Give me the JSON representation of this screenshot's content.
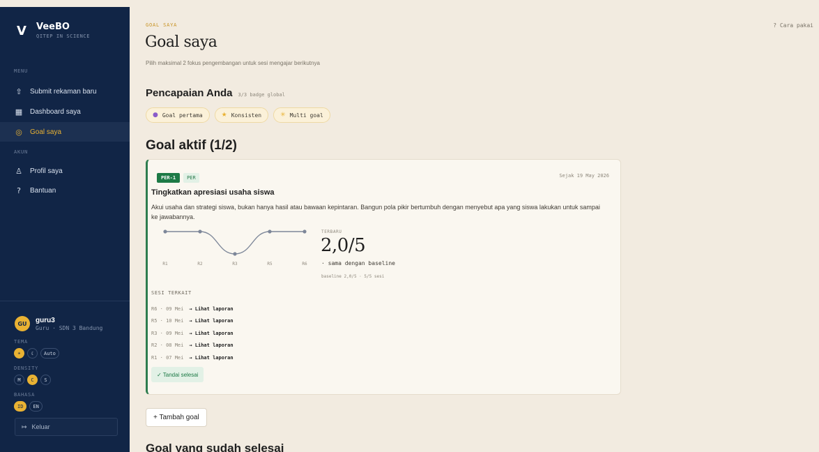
{
  "sidebar": {
    "brand": {
      "logo": "V",
      "name": "VeeBO",
      "subtitle": "QITEP IN SCIENCE"
    },
    "menu_label": "MENU",
    "menu_items": [
      {
        "label": "Submit rekaman baru",
        "icon": "upload-icon",
        "glyph": "⇧"
      },
      {
        "label": "Dashboard saya",
        "icon": "grid-icon",
        "glyph": "▦"
      },
      {
        "label": "Goal saya",
        "icon": "target-icon",
        "glyph": "◎",
        "active": true
      }
    ],
    "account_label": "AKUN",
    "account_items": [
      {
        "label": "Profil saya",
        "icon": "user-icon",
        "glyph": "♙"
      },
      {
        "label": "Bantuan",
        "icon": "help-icon",
        "glyph": "?"
      }
    ],
    "user": {
      "initials": "GU",
      "name": "guru3",
      "role": "Guru · SDN 3 Bandung"
    },
    "theme": {
      "label": "TEMA",
      "options": [
        "☀",
        "☾",
        "Auto"
      ],
      "selected": "☀"
    },
    "density": {
      "label": "DENSITY",
      "options": [
        "M",
        "C",
        "S"
      ],
      "selected": "C"
    },
    "language": {
      "label": "BAHASA",
      "options": [
        "ID",
        "EN"
      ],
      "selected": "ID"
    },
    "logout_icon": "logout-icon",
    "logout_label": "Keluar"
  },
  "header": {
    "eyebrow": "GOAL SAYA",
    "title": "Goal saya",
    "subtitle": "Pilih maksimal 2 fokus pengembangan untuk sesi mengajar berikutnya",
    "help": "? Cara pakai"
  },
  "achievements": {
    "title": "Pencapaian Anda",
    "count": "3/3 badge global",
    "badges": [
      {
        "label": "Goal pertama",
        "icon": "target-icon",
        "glyph": "●",
        "color": "#8a5cc9"
      },
      {
        "label": "Konsisten",
        "icon": "star-icon",
        "glyph": "★",
        "color": "#e9b233"
      },
      {
        "label": "Multi goal",
        "icon": "sparkle-icon",
        "glyph": "✳",
        "color": "#e9b233"
      }
    ]
  },
  "active_goals": {
    "title": "Goal aktif (1/2)",
    "goals": [
      {
        "code": "PER-1",
        "category": "PER",
        "since": "Sejak 19 May 2026",
        "title": "Tingkatkan apresiasi usaha siswa",
        "description": "Akui usaha dan strategi siswa, bukan hanya hasil atau bawaan kepintaran. Bangun pola pikir bertumbuh dengan menyebut apa yang siswa lakukan untuk sampai ke jawabannya.",
        "trend": {
          "labels": [
            "R1",
            "R2",
            "R3",
            "R5",
            "R6"
          ],
          "values": [
            2,
            2,
            1,
            2,
            2
          ],
          "ylim": [
            0,
            5
          ]
        },
        "latest_label": "TERBARU",
        "latest_value": "2,0/5",
        "comparison": "· sama dengan baseline",
        "baseline": "baseline 2,0/5 · 5/5 sesi",
        "sessions_label": "SESI TERKAIT",
        "sessions": [
          {
            "meta": "R6 · 09 Mei",
            "link": "→ Lihat laporan"
          },
          {
            "meta": "R5 · 10 Mei",
            "link": "→ Lihat laporan"
          },
          {
            "meta": "R3 · 09 Mei",
            "link": "→ Lihat laporan"
          },
          {
            "meta": "R2 · 08 Mei",
            "link": "→ Lihat laporan"
          },
          {
            "meta": "R1 · 07 Mei",
            "link": "→ Lihat laporan"
          }
        ],
        "done_label": "✓ Tandai selesai"
      }
    ]
  },
  "add_goal_label": "+ Tambah goal",
  "completed_title": "Goal yang sudah selesai",
  "colors": {
    "sidebar": "#112546",
    "accent": "#e9b233",
    "success": "#1d7a46",
    "background": "#f2ebe0"
  }
}
